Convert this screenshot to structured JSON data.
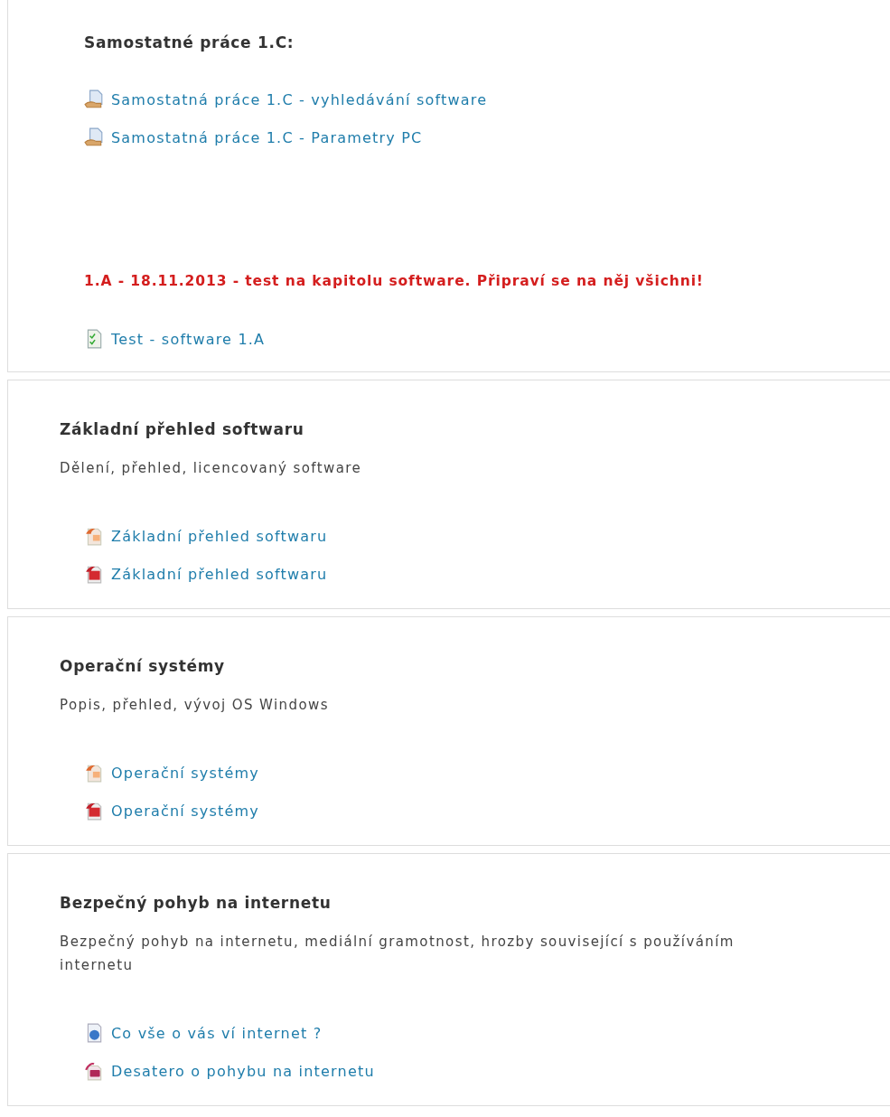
{
  "sections": [
    {
      "content": [
        {
          "kind": "heading",
          "text": "Samostatné práce 1.C:"
        },
        {
          "kind": "assignment",
          "text": "Samostatná práce 1.C - vyhledávání software"
        },
        {
          "kind": "assignment",
          "text": "Samostatná práce 1.C - Parametry PC"
        },
        {
          "kind": "notice",
          "text": "1.A - 18.11.2013 - test na kapitolu software. Připraví se na něj všichni!"
        },
        {
          "kind": "quiz",
          "text": "Test - software 1.A"
        }
      ]
    },
    {
      "title": "Základní přehled softwaru",
      "summary": "Dělení, přehled, licencovaný software",
      "content": [
        {
          "kind": "slides",
          "text": "Základní přehled softwaru"
        },
        {
          "kind": "pdf",
          "text": "Základní přehled softwaru"
        }
      ]
    },
    {
      "title": "Operační systémy",
      "summary": "Popis, přehled, vývoj OS Windows",
      "content": [
        {
          "kind": "slides",
          "text": "Operační systémy"
        },
        {
          "kind": "pdf",
          "text": "Operační systémy"
        }
      ]
    },
    {
      "title": "Bezpečný pohyb na internetu",
      "summary": "Bezpečný pohyb na internetu, mediální gramotnost, hrozby související s používáním internetu",
      "content": [
        {
          "kind": "web",
          "text": "Co vše o vás ví internet ?"
        },
        {
          "kind": "media",
          "text": "Desatero o pohybu na internetu"
        }
      ]
    }
  ]
}
